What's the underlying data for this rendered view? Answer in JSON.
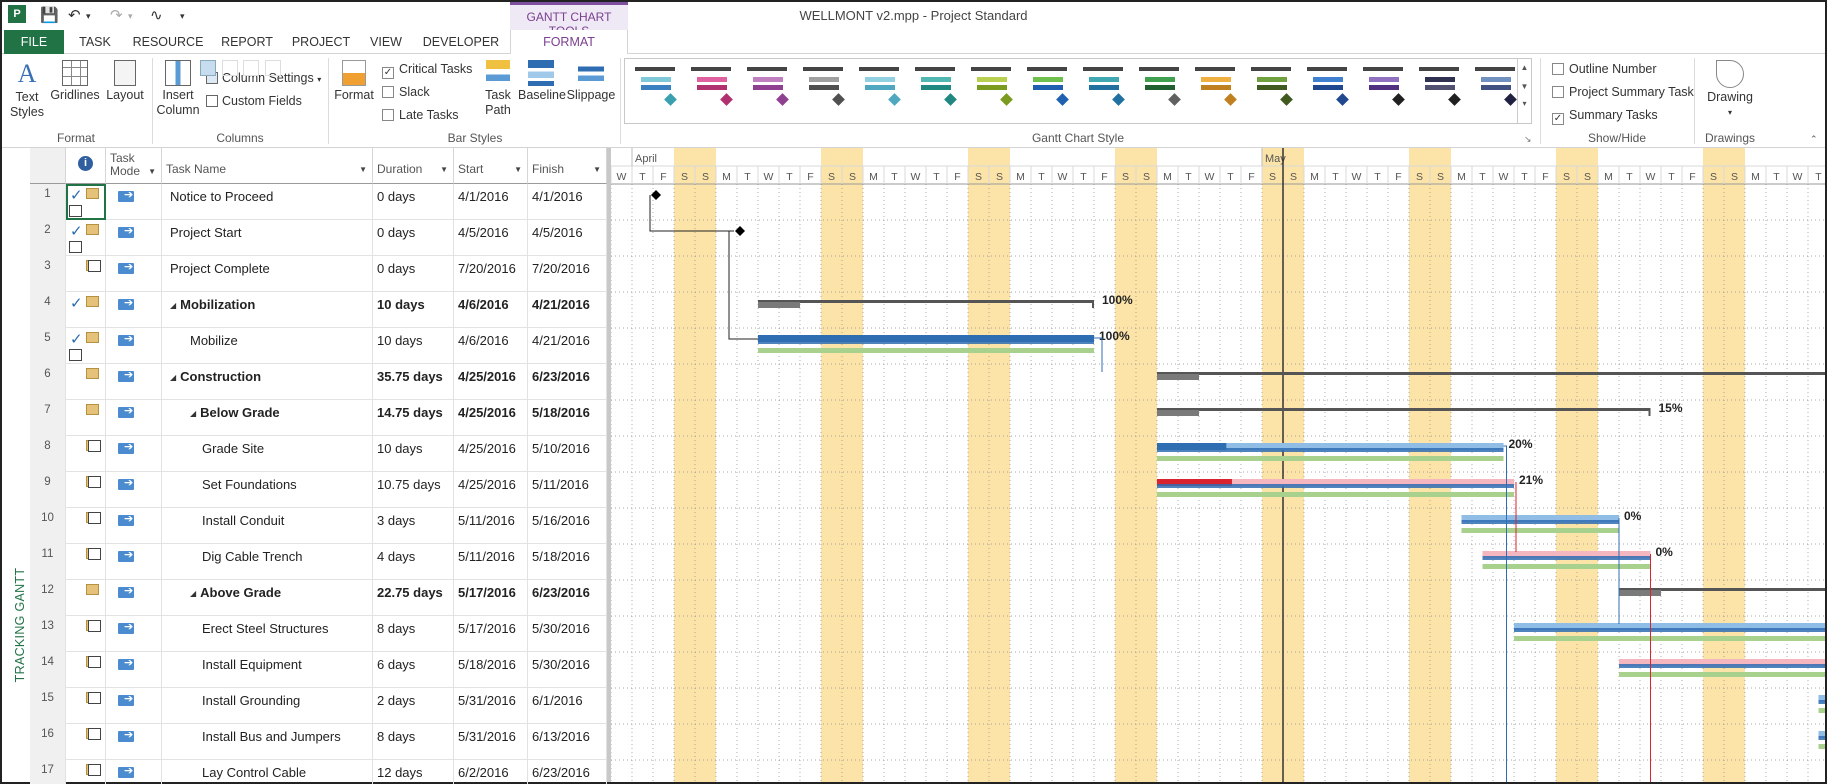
{
  "window": {
    "title": "WELLMONT v2.mpp - Project Standard"
  },
  "context_tab_group": "GANTT CHART TOOLS",
  "tabs": [
    {
      "label": "FILE"
    },
    {
      "label": "TASK"
    },
    {
      "label": "RESOURCE"
    },
    {
      "label": "REPORT"
    },
    {
      "label": "PROJECT"
    },
    {
      "label": "VIEW"
    },
    {
      "label": "DEVELOPER"
    },
    {
      "label": "FORMAT"
    }
  ],
  "ribbon": {
    "format_group": {
      "label": "Format",
      "text_styles": "Text Styles",
      "gridlines": "Gridlines",
      "layout": "Layout"
    },
    "columns_group": {
      "label": "Columns",
      "insert_column": "Insert Column",
      "column_settings": "Column Settings",
      "custom_fields": "Custom Fields"
    },
    "bar_styles_group": {
      "label": "Bar Styles",
      "format": "Format",
      "critical_tasks": "Critical Tasks",
      "critical_tasks_checked": true,
      "slack": "Slack",
      "slack_checked": false,
      "late_tasks": "Late Tasks",
      "late_tasks_checked": false,
      "task_path": "Task Path",
      "baseline": "Baseline",
      "slippage": "Slippage"
    },
    "gantt_chart_style_group": {
      "label": "Gantt Chart Style",
      "styles": [
        {
          "t1": "#7ec8d8",
          "t2": "#3a7fc0",
          "dm": "#3aa0b0"
        },
        {
          "t1": "#e060a0",
          "t2": "#b03070",
          "dm": "#b03070"
        },
        {
          "t1": "#c080c0",
          "t2": "#904090",
          "dm": "#904090"
        },
        {
          "t1": "#a0a0a0",
          "t2": "#505050",
          "dm": "#505050"
        },
        {
          "t1": "#90d0e0",
          "t2": "#50a8c0",
          "dm": "#50a8c0"
        },
        {
          "t1": "#50b8b0",
          "t2": "#208880",
          "dm": "#208880"
        },
        {
          "t1": "#b8d050",
          "t2": "#7a9a20",
          "dm": "#7a9a20"
        },
        {
          "t1": "#70c050",
          "t2": "#2060b0",
          "dm": "#2060b0"
        },
        {
          "t1": "#40a8b0",
          "t2": "#2070a0",
          "dm": "#2070a0"
        },
        {
          "t1": "#40a050",
          "t2": "#206030",
          "dm": "#606060"
        },
        {
          "t1": "#f0b040",
          "t2": "#c08020",
          "dm": "#c08020"
        },
        {
          "t1": "#70a040",
          "t2": "#405a20",
          "dm": "#405a20"
        },
        {
          "t1": "#4080d0",
          "t2": "#204890",
          "dm": "#204890"
        },
        {
          "t1": "#9070c0",
          "t2": "#503080",
          "dm": "#202020"
        },
        {
          "t1": "#303050",
          "t2": "#505070",
          "dm": "#202020"
        },
        {
          "t1": "#7090c0",
          "t2": "#405080",
          "dm": "#202040"
        }
      ]
    },
    "show_hide_group": {
      "label": "Show/Hide",
      "outline_number": "Outline Number",
      "outline_number_checked": false,
      "project_summary_task": "Project Summary Task",
      "project_summary_task_checked": false,
      "summary_tasks": "Summary Tasks",
      "summary_tasks_checked": true
    },
    "drawings_group": {
      "label": "Drawings",
      "drawing": "Drawing"
    }
  },
  "view_name": "TRACKING GANTT",
  "columns": {
    "task_mode": "Task Mode",
    "task_name": "Task Name",
    "duration": "Duration",
    "start": "Start",
    "finish": "Finish"
  },
  "tasks": [
    {
      "id": "1",
      "name": "Notice to Proceed",
      "duration": "0 days",
      "start": "4/1/2016",
      "finish": "4/1/2016",
      "level": 0,
      "summary": false,
      "done": true
    },
    {
      "id": "2",
      "name": "Project Start",
      "duration": "0 days",
      "start": "4/5/2016",
      "finish": "4/5/2016",
      "level": 0,
      "summary": false,
      "done": true
    },
    {
      "id": "3",
      "name": "Project Complete",
      "duration": "0 days",
      "start": "7/20/2016",
      "finish": "7/20/2016",
      "level": 0,
      "summary": false,
      "done": false
    },
    {
      "id": "4",
      "name": "Mobilization",
      "duration": "10 days",
      "start": "4/6/2016",
      "finish": "4/21/2016",
      "level": 0,
      "summary": true,
      "done": true
    },
    {
      "id": "5",
      "name": "Mobilize",
      "duration": "10 days",
      "start": "4/6/2016",
      "finish": "4/21/2016",
      "level": 1,
      "summary": false,
      "done": true
    },
    {
      "id": "6",
      "name": "Construction",
      "duration": "35.75 days",
      "start": "4/25/2016",
      "finish": "6/23/2016",
      "level": 0,
      "summary": true,
      "done": false
    },
    {
      "id": "7",
      "name": "Below Grade",
      "duration": "14.75 days",
      "start": "4/25/2016",
      "finish": "5/18/2016",
      "level": 1,
      "summary": true,
      "done": false
    },
    {
      "id": "8",
      "name": "Grade Site",
      "duration": "10 days",
      "start": "4/25/2016",
      "finish": "5/10/2016",
      "level": 2,
      "summary": false,
      "done": false
    },
    {
      "id": "9",
      "name": "Set Foundations",
      "duration": "10.75 days",
      "start": "4/25/2016",
      "finish": "5/11/2016",
      "level": 2,
      "summary": false,
      "done": false
    },
    {
      "id": "10",
      "name": "Install Conduit",
      "duration": "3 days",
      "start": "5/11/2016",
      "finish": "5/16/2016",
      "level": 2,
      "summary": false,
      "done": false
    },
    {
      "id": "11",
      "name": "Dig Cable Trench",
      "duration": "4 days",
      "start": "5/11/2016",
      "finish": "5/18/2016",
      "level": 2,
      "summary": false,
      "done": false
    },
    {
      "id": "12",
      "name": "Above Grade",
      "duration": "22.75 days",
      "start": "5/17/2016",
      "finish": "6/23/2016",
      "level": 1,
      "summary": true,
      "done": false
    },
    {
      "id": "13",
      "name": "Erect Steel Structures",
      "duration": "8 days",
      "start": "5/17/2016",
      "finish": "5/30/2016",
      "level": 2,
      "summary": false,
      "done": false
    },
    {
      "id": "14",
      "name": "Install Equipment",
      "duration": "6 days",
      "start": "5/18/2016",
      "finish": "5/30/2016",
      "level": 2,
      "summary": false,
      "done": false
    },
    {
      "id": "15",
      "name": "Install Grounding",
      "duration": "2 days",
      "start": "5/31/2016",
      "finish": "6/1/2016",
      "level": 2,
      "summary": false,
      "done": false
    },
    {
      "id": "16",
      "name": "Install Bus and Jumpers",
      "duration": "8 days",
      "start": "5/31/2016",
      "finish": "6/13/2016",
      "level": 2,
      "summary": false,
      "done": false
    },
    {
      "id": "17",
      "name": "Lay Control Cable",
      "duration": "12 days",
      "start": "6/2/2016",
      "finish": "6/23/2016",
      "level": 2,
      "summary": false,
      "done": false
    }
  ],
  "timescale": {
    "months": [
      {
        "label": "April",
        "day_index": 1
      },
      {
        "label": "May",
        "day_index": 31
      }
    ],
    "first_day": "W",
    "day_letters": [
      "W",
      "T",
      "F",
      "S",
      "S",
      "M",
      "T",
      "W",
      "T",
      "F",
      "S",
      "S",
      "M",
      "T",
      "W",
      "T",
      "F",
      "S",
      "S",
      "M",
      "T",
      "W",
      "T",
      "F",
      "S",
      "S",
      "M",
      "T",
      "W",
      "T",
      "F",
      "S",
      "S",
      "M",
      "T",
      "W",
      "T",
      "F",
      "S",
      "S",
      "M",
      "T",
      "W",
      "T",
      "F",
      "S",
      "S",
      "M",
      "T",
      "W",
      "T",
      "F",
      "S",
      "S",
      "M",
      "T",
      "W",
      "T",
      "F",
      "S",
      "S",
      "M",
      "T",
      "W",
      "T"
    ],
    "weekend_start_day_indices": [
      3,
      10,
      17,
      24,
      31,
      38,
      45,
      52,
      59
    ],
    "weekend_color": "#fce4a8",
    "status_date_day_index": 32
  },
  "gantt_bars": [
    {
      "row": 1,
      "type": "milestone",
      "day": 2
    },
    {
      "row": 2,
      "type": "milestone",
      "day": 6
    },
    {
      "row": 4,
      "type": "summary",
      "start": 7,
      "end": 23,
      "pct": "100%"
    },
    {
      "row": 5,
      "type": "task",
      "start": 7,
      "end": 23,
      "pct": "100%",
      "progress": 1.0
    },
    {
      "row": 6,
      "type": "summary",
      "start": 26,
      "end": 59.5,
      "pct": ""
    },
    {
      "row": 7,
      "type": "summary",
      "start": 26,
      "end": 49.5,
      "pct": "15%"
    },
    {
      "row": 8,
      "type": "task",
      "start": 26,
      "end": 42.5,
      "pct": "20%",
      "progress": 0.2
    },
    {
      "row": 9,
      "type": "critical",
      "start": 26,
      "end": 43,
      "pct": "21%",
      "progress": 0.21
    },
    {
      "row": 10,
      "type": "task",
      "start": 40.5,
      "end": 48,
      "pct": "0%",
      "progress": 0
    },
    {
      "row": 11,
      "type": "critical",
      "start": 41.5,
      "end": 49.5,
      "pct": "0%",
      "progress": 0
    },
    {
      "row": 12,
      "type": "summary",
      "start": 48,
      "end": 59.5,
      "pct": ""
    },
    {
      "row": 13,
      "type": "task",
      "start": 43,
      "end": 59.5,
      "pct": "",
      "progress": 0
    },
    {
      "row": 14,
      "type": "critical",
      "start": 48,
      "end": 59.5,
      "pct": "",
      "progress": 0
    },
    {
      "row": 15,
      "type": "task",
      "start": 57.5,
      "end": 59.5,
      "pct": "",
      "progress": 0
    },
    {
      "row": 16,
      "type": "task",
      "start": 57.5,
      "end": 59.5,
      "pct": "",
      "progress": 0
    }
  ]
}
